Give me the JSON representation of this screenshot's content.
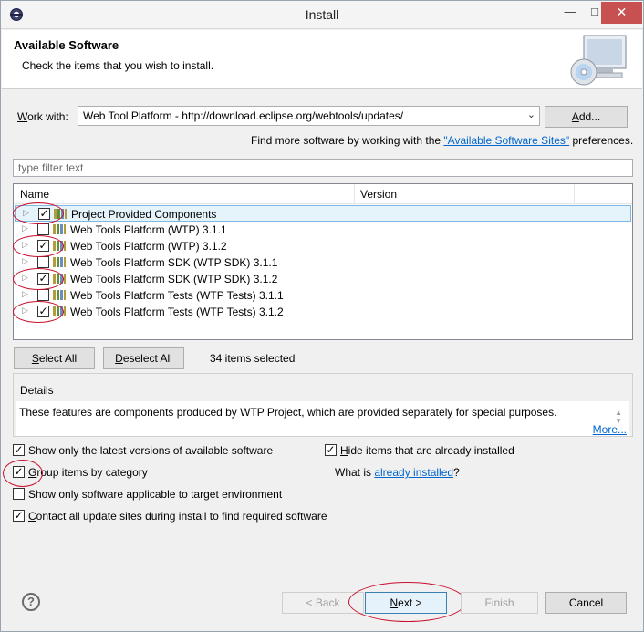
{
  "window": {
    "title": "Install"
  },
  "banner": {
    "title": "Available Software",
    "description": "Check the items that you wish to install."
  },
  "work_with": {
    "label_prefix": "",
    "label_accel": "W",
    "label_rest": "ork with:",
    "value": "Web Tool Platform - http://download.eclipse.org/webtools/updates/",
    "add_label_accel": "A",
    "add_label_rest": "dd..."
  },
  "find_more": {
    "prefix": "Find more software by working with the ",
    "link": "\"Available Software Sites\"",
    "suffix": " preferences."
  },
  "filter": {
    "placeholder": "type filter text"
  },
  "tree": {
    "columns": [
      "Name",
      "Version"
    ],
    "rows": [
      {
        "label": "Project Provided Components",
        "checked": true,
        "selected": true
      },
      {
        "label": "Web Tools Platform (WTP) 3.1.1",
        "checked": false
      },
      {
        "label": "Web Tools Platform (WTP) 3.1.2",
        "checked": true
      },
      {
        "label": "Web Tools Platform SDK (WTP SDK) 3.1.1",
        "checked": false
      },
      {
        "label": "Web Tools Platform SDK (WTP SDK) 3.1.2",
        "checked": true
      },
      {
        "label": "Web Tools Platform Tests (WTP Tests) 3.1.1",
        "checked": false
      },
      {
        "label": "Web Tools Platform Tests (WTP Tests) 3.1.2",
        "checked": true
      }
    ]
  },
  "selection": {
    "select_all_accel": "S",
    "select_all_rest": "elect All",
    "deselect_all_accel": "D",
    "deselect_all_rest": "eselect All",
    "count_text": "34 items selected"
  },
  "details": {
    "title": "Details",
    "text": "These features are components produced by WTP Project, which are provided separately for special purposes.",
    "more": "More..."
  },
  "options": {
    "latest_only": {
      "label": "Show only the latest versions of available software",
      "checked": true
    },
    "hide_installed": {
      "label_accel": "H",
      "label_rest": "ide items that are already installed",
      "checked": true
    },
    "group_by_category": {
      "label_accel": "G",
      "label_rest": "roup items by category",
      "checked": true
    },
    "what_is_prefix": "What is ",
    "what_is_link": "already installed",
    "what_is_suffix": "?",
    "applicable_only": {
      "label": "Show only software applicable to target environment",
      "checked": false
    },
    "contact_sites": {
      "label_accel": "C",
      "label_rest": "ontact all update sites during install to find required software",
      "checked": true
    }
  },
  "footer": {
    "back_label": "< Back",
    "next_label_accel": "N",
    "next_label_rest": "ext >",
    "finish_label": "Finish",
    "cancel_label": "Cancel"
  },
  "colors": {
    "accent_link": "#0066cc",
    "annotation_red": "#c8102e",
    "close_button": "#c75050",
    "selected_row": "#e5f3fb"
  }
}
